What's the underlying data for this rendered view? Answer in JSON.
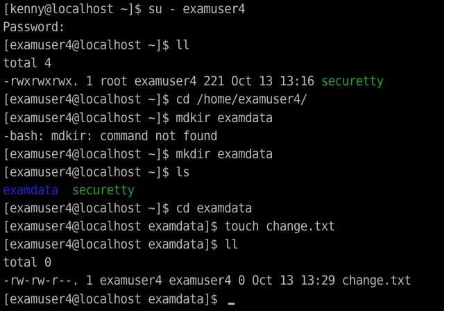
{
  "terminal": {
    "lines": [
      [
        {
          "text": "[kenny@localhost ~]$ su - examuser4",
          "color": "normal"
        }
      ],
      [
        {
          "text": "Password:",
          "color": "normal"
        }
      ],
      [
        {
          "text": "[examuser4@localhost ~]$ ll",
          "color": "normal"
        }
      ],
      [
        {
          "text": "total 4",
          "color": "normal"
        }
      ],
      [
        {
          "text": "-rwxrwxrwx. 1 root examuser4 221 Oct 13 13:16 ",
          "color": "normal"
        },
        {
          "text": "securetty",
          "color": "green"
        }
      ],
      [
        {
          "text": "[examuser4@localhost ~]$ cd /home/examuser4/",
          "color": "normal"
        }
      ],
      [
        {
          "text": "[examuser4@localhost ~]$ mdkir examdata",
          "color": "normal"
        }
      ],
      [
        {
          "text": "-bash: mdkir: command not found",
          "color": "normal"
        }
      ],
      [
        {
          "text": "[examuser4@localhost ~]$ mkdir examdata",
          "color": "normal"
        }
      ],
      [
        {
          "text": "[examuser4@localhost ~]$ ls",
          "color": "normal"
        }
      ],
      [
        {
          "text": "examdata",
          "color": "blue"
        },
        {
          "text": "  ",
          "color": "normal"
        },
        {
          "text": "securetty",
          "color": "green"
        }
      ],
      [
        {
          "text": "[examuser4@localhost ~]$ cd examdata",
          "color": "normal"
        }
      ],
      [
        {
          "text": "[examuser4@localhost examdata]$ touch change.txt",
          "color": "normal"
        }
      ],
      [
        {
          "text": "[examuser4@localhost examdata]$ ll",
          "color": "normal"
        }
      ],
      [
        {
          "text": "total 0",
          "color": "normal"
        }
      ],
      [
        {
          "text": "-rw-rw-r--. 1 examuser4 examuser4 0 Oct 13 13:29 change.txt",
          "color": "normal"
        }
      ],
      [
        {
          "text": "[examuser4@localhost examdata]$ ",
          "color": "normal"
        }
      ]
    ],
    "colors": {
      "background": "#000000",
      "foreground": "#b8b8b8",
      "green": "#1ea51e",
      "blue": "#2020d0"
    },
    "cursor_line": 16
  }
}
